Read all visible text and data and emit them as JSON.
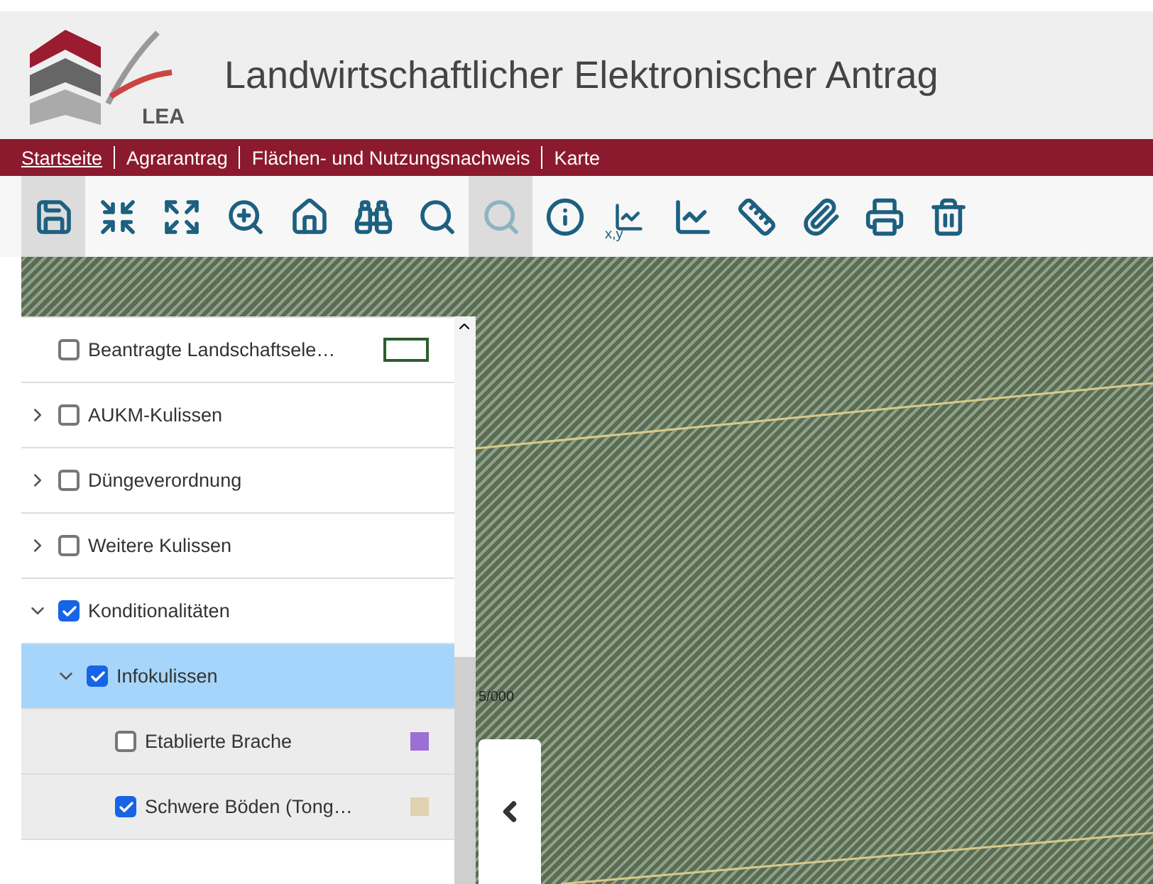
{
  "header": {
    "logo_text": "LEA",
    "title": "Landwirtschaftlicher Elektronischer Antrag"
  },
  "nav": [
    {
      "label": "Startseite",
      "selected": true
    },
    {
      "label": "Agrarantrag",
      "selected": false
    },
    {
      "label": "Flächen- und Nutzungsnachweis",
      "selected": false
    },
    {
      "label": "Karte",
      "selected": false
    }
  ],
  "toolbar": [
    {
      "kind": "save",
      "selected": true
    },
    {
      "kind": "collapse",
      "selected": false
    },
    {
      "kind": "expand",
      "selected": false
    },
    {
      "kind": "zoom-in",
      "selected": false
    },
    {
      "kind": "home",
      "selected": false
    },
    {
      "kind": "binoculars",
      "selected": false
    },
    {
      "kind": "zoom-back",
      "selected": false
    },
    {
      "kind": "zoom-forward",
      "selected": true
    },
    {
      "kind": "info",
      "selected": false
    },
    {
      "kind": "coordinates",
      "label": "x,y",
      "selected": false
    },
    {
      "kind": "measure-line",
      "selected": false
    },
    {
      "kind": "measure-area",
      "selected": false
    },
    {
      "kind": "pin",
      "selected": false
    },
    {
      "kind": "print",
      "selected": false
    },
    {
      "kind": "delete",
      "selected": false
    }
  ],
  "map": {
    "scale_text": "5/000"
  },
  "layers": [
    {
      "label": "Beantragte Landschaftsele…",
      "checked": false,
      "kind": "outline",
      "color": "#2e5e2e",
      "selected": false
    },
    {
      "label": "AUKM-Kulissen",
      "checked": false,
      "expanded": false,
      "selected": false
    },
    {
      "label": "Düngeverordnung",
      "checked": false,
      "expanded": false,
      "selected": false
    },
    {
      "label": "Weitere Kulissen",
      "checked": false,
      "expanded": false,
      "selected": false
    },
    {
      "label": "Konditionalitäten",
      "checked": true,
      "expanded": true,
      "selected": false,
      "children": [
        {
          "label": "Infokulissen",
          "checked": true,
          "expanded": true,
          "selected": true,
          "children": [
            {
              "label": "Etablierte Brache",
              "checked": false,
              "kind": "pattern",
              "color": "#9b6fd6",
              "selected": false
            },
            {
              "label": "Schwere Böden (Tong…",
              "checked": true,
              "kind": "pattern",
              "color": "#e0d2b0",
              "selected": false
            }
          ]
        }
      ]
    }
  ]
}
